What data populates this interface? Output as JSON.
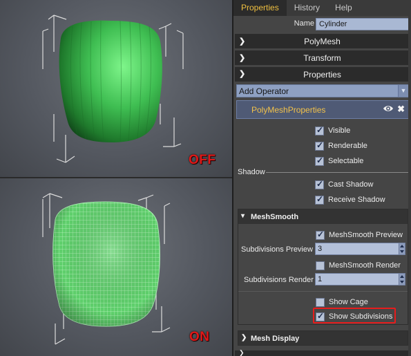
{
  "viewports": {
    "top_label": "OFF",
    "bottom_label": "ON"
  },
  "tabs": [
    {
      "label": "Properties",
      "active": true
    },
    {
      "label": "History",
      "active": false
    },
    {
      "label": "Help",
      "active": false
    }
  ],
  "name_field": {
    "label": "Name",
    "value": "Cylinder"
  },
  "sections": {
    "polymesh": "PolyMesh",
    "transform": "Transform",
    "properties": "Properties"
  },
  "add_operator": {
    "label": "Add Operator"
  },
  "operator": {
    "name": "PolyMeshProperties"
  },
  "visibility": {
    "visible": {
      "label": "Visible",
      "checked": true
    },
    "renderable": {
      "label": "Renderable",
      "checked": true
    },
    "selectable": {
      "label": "Selectable",
      "checked": true
    }
  },
  "shadow": {
    "label": "Shadow",
    "cast": {
      "label": "Cast Shadow",
      "checked": true
    },
    "receive": {
      "label": "Receive Shadow",
      "checked": true
    }
  },
  "meshsmooth": {
    "title": "MeshSmooth",
    "preview": {
      "label": "MeshSmooth Preview",
      "checked": true
    },
    "subdiv_preview": {
      "label": "Subdivisions Preview",
      "value": "3"
    },
    "render": {
      "label": "MeshSmooth Render",
      "checked": false
    },
    "subdiv_render": {
      "label": "Subdivisions Render",
      "value": "1"
    },
    "show_cage": {
      "label": "Show Cage",
      "checked": false
    },
    "show_subdivisions": {
      "label": "Show Subdivisions",
      "checked": true
    }
  },
  "mesh_display": {
    "title": "Mesh Display"
  },
  "colors": {
    "accent_tab": "#f0c040",
    "highlight": "#e81c1c",
    "mesh_green": "#3fbe52"
  }
}
